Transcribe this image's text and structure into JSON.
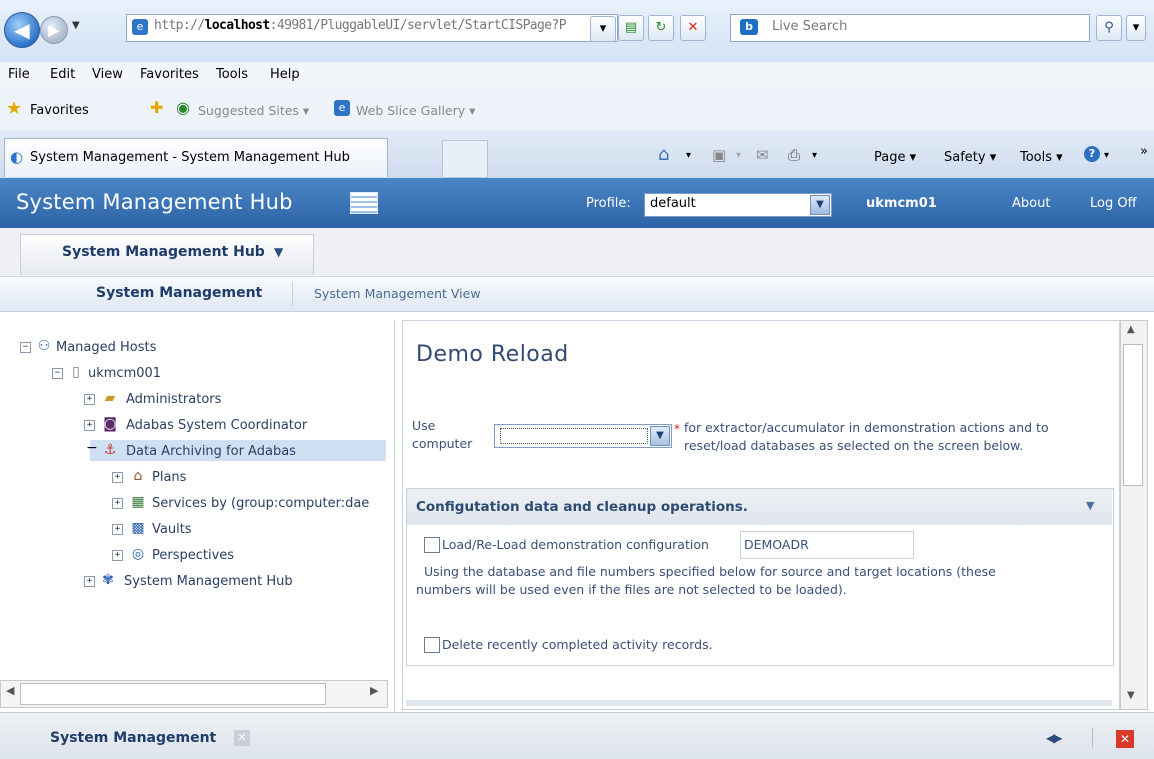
{
  "browser": {
    "address": {
      "prefix": "http://",
      "host": "localhost",
      "rest": ":49981/PluggableUI/servlet/StartCISPage?P"
    },
    "search_placeholder": "Live Search",
    "menu": [
      "File",
      "Edit",
      "View",
      "Favorites",
      "Tools",
      "Help"
    ],
    "favorites": {
      "label": "Favorites",
      "suggested": "Suggested Sites ▾",
      "webslice": "Web Slice Gallery ▾"
    },
    "tab_title": "System Management - System Management Hub",
    "commands": {
      "page": "Page ▾",
      "safety": "Safety ▾",
      "tools": "Tools ▾",
      "more": "»"
    }
  },
  "header": {
    "title": "System Management Hub",
    "profile_label": "Profile:",
    "profile_value": "default",
    "user": "ukmcm01",
    "about": "About",
    "logoff": "Log Off"
  },
  "hub_tab": {
    "label": "System Management Hub"
  },
  "subnav": {
    "active": "System Management",
    "view": "System Management View"
  },
  "tree": {
    "root": "Managed Hosts",
    "host": "ukmcm001",
    "items": [
      "Administrators",
      "Adabas System Coordinator",
      "Data Archiving for Adabas"
    ],
    "children": [
      "Plans",
      "Services by (group:computer:dae",
      "Vaults",
      "Perspectives"
    ],
    "smh": "System Management Hub"
  },
  "main": {
    "title": "Demo Reload",
    "use_label_1": "Use",
    "use_label_2": "computer",
    "required": "*",
    "desc_1": "for extractor/accumulator in demonstration actions and to",
    "desc_2": "reset/load databases as selected on the screen below.",
    "section_title": "Configutation data and cleanup operations.",
    "load_label": "Load/Re-Load demonstration configuration",
    "load_value": "DEMOADR",
    "using_1": "Using the database and file numbers specified below for source and target locations (these",
    "using_2": "numbers will be used even if the files are not selected to be loaded).",
    "delete_label": "Delete recently completed activity records."
  },
  "bottom": {
    "label": "System Management"
  },
  "colors": {
    "header": "#3a74b8",
    "accent": "#2f4a72",
    "selected": "#cfe0f3"
  }
}
